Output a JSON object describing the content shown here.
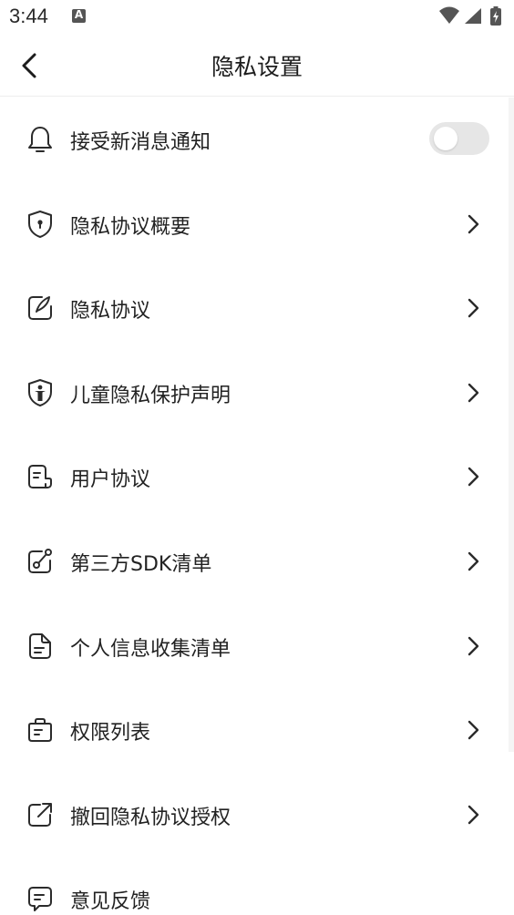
{
  "status_bar": {
    "time": "3:44",
    "notification_icon_letter": "A"
  },
  "nav": {
    "title": "隐私设置"
  },
  "items": [
    {
      "label": "接受新消息通知",
      "icon": "bell-icon",
      "control": "toggle",
      "toggle_on": false
    },
    {
      "label": "隐私协议概要",
      "icon": "shield-keyhole-icon",
      "control": "chevron"
    },
    {
      "label": "隐私协议",
      "icon": "edit-note-icon",
      "control": "chevron"
    },
    {
      "label": "儿童隐私保护声明",
      "icon": "child-shield-icon",
      "control": "chevron"
    },
    {
      "label": "用户协议",
      "icon": "agreement-doc-icon",
      "control": "chevron"
    },
    {
      "label": "第三方SDK清单",
      "icon": "sdk-link-icon",
      "control": "chevron"
    },
    {
      "label": "个人信息收集清单",
      "icon": "document-list-icon",
      "control": "chevron"
    },
    {
      "label": "权限列表",
      "icon": "permission-bag-icon",
      "control": "chevron"
    },
    {
      "label": "撤回隐私协议授权",
      "icon": "revoke-share-icon",
      "control": "chevron"
    },
    {
      "label": "意见反馈",
      "icon": "feedback-chat-icon",
      "control": "none"
    }
  ],
  "colors": {
    "icon_stroke": "#2b2b2b",
    "toggle_off_track": "#e6e6e6",
    "divider": "#ededed"
  }
}
